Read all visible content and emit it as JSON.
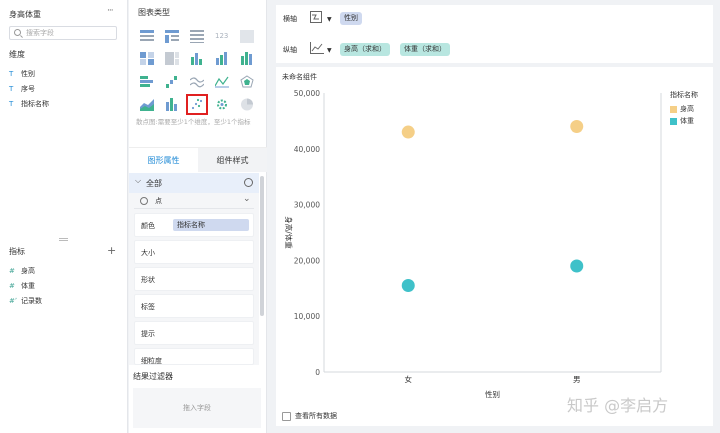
{
  "dataset": {
    "title": "身高体重",
    "more": "···",
    "search_placeholder": "搜索字段"
  },
  "dimensions": {
    "label": "维度",
    "fields": [
      "性别",
      "序号",
      "指标名称"
    ],
    "icon": "T"
  },
  "measures": {
    "label": "指标",
    "fields": [
      "身高",
      "体重",
      "记录数"
    ],
    "icons": [
      "#",
      "#",
      "#ʼ"
    ]
  },
  "chart_type": {
    "title": "图表类型",
    "selected": "scatter",
    "tip": "散点图:需要至少1个维度，至少1个指标"
  },
  "tabs": {
    "graph_props": "图形属性",
    "component_style": "组件样式"
  },
  "props": {
    "all": "全部",
    "mark_type": "点",
    "color": "颜色",
    "color_field": "指标名称",
    "size": "大小",
    "shape": "形状",
    "label": "标签",
    "tooltip": "提示",
    "granularity": "细粒度"
  },
  "result_filter": {
    "title": "结果过滤器",
    "drop_hint": "拖入字段"
  },
  "axes": {
    "x_label": "横轴",
    "y_label": "纵轴",
    "x_fields": [
      "性别"
    ],
    "y_fields": [
      "身高（求和）",
      "体重（求和）"
    ]
  },
  "chart_card": {
    "title": "未命名组件",
    "view_all": "查看所有数据"
  },
  "colors": {
    "height": "#f5cf87",
    "weight": "#3fc1c9",
    "accent": "#1f8ad6",
    "highlight": "#e02020"
  },
  "chart_data": {
    "type": "scatter",
    "categories": [
      "女",
      "男"
    ],
    "series": [
      {
        "name": "身高",
        "values": [
          43000,
          44000
        ]
      },
      {
        "name": "体重",
        "values": [
          15500,
          19000
        ]
      }
    ],
    "xlabel": "性别",
    "ylabel": "身高/体重",
    "ylim": [
      0,
      50000
    ],
    "yticks": [
      "0",
      "10,000",
      "20,000",
      "30,000",
      "40,000",
      "50,000"
    ],
    "legend_title": "指标名称",
    "legend_position": "top-right",
    "grid": false
  },
  "watermark": "知乎 @李启方"
}
